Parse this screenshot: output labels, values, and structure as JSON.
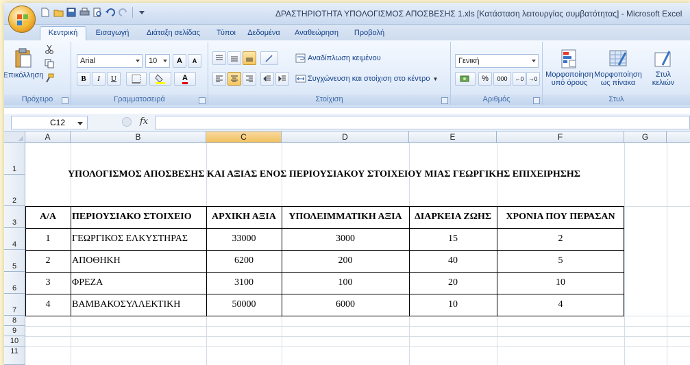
{
  "window": {
    "title": "ΔΡΑΣΤΗΡΙΟΤΗΤΑ ΥΠΟΛΟΓΙΣΜΟΣ ΑΠΟΣΒΕΣΗΣ 1.xls [Κατάσταση λειτουργίας συμβατότητας] - Microsoft Excel"
  },
  "tabs": [
    {
      "label": "Κεντρική",
      "active": true
    },
    {
      "label": "Εισαγωγή"
    },
    {
      "label": "Διάταξη σελίδας"
    },
    {
      "label": "Τύποι"
    },
    {
      "label": "Δεδομένα"
    },
    {
      "label": "Αναθεώρηση"
    },
    {
      "label": "Προβολή"
    }
  ],
  "ribbon": {
    "clipboard": {
      "paste_label": "Επικόλληση",
      "group_label": "Πρόχειρο"
    },
    "font": {
      "font_name": "Arial",
      "font_size": "10",
      "group_label": "Γραμματοσειρά",
      "bold": "B",
      "italic": "I",
      "underline": "U",
      "grow": "A",
      "shrink": "A",
      "color": "A"
    },
    "alignment": {
      "wrap_text": "Αναδίπλωση κειμένου",
      "merge_center": "Συγχώνευση και στοίχιση στο κέντρο",
      "group_label": "Στοίχιση"
    },
    "number": {
      "format": "Γενική",
      "percent": "%",
      "thousands": "000",
      "group_label": "Αριθμός"
    },
    "styles": {
      "conditional": "Μορφοποίηση",
      "conditional_sub": "υπό όρους",
      "table": "Μορφοποίηση",
      "table_sub": "ως πίνακα",
      "cell_styles": "Στυλ",
      "cell_styles_sub": "κελιών",
      "group_label": "Στυλ"
    }
  },
  "formula_bar": {
    "name_box": "C12",
    "fx": "fx",
    "content": ""
  },
  "columns": [
    "A",
    "B",
    "C",
    "D",
    "E",
    "F",
    "G"
  ],
  "selected_column": "C",
  "rows": [
    "1",
    "2",
    "3",
    "4",
    "5",
    "6",
    "7",
    "8",
    "9",
    "10",
    "11"
  ],
  "sheet": {
    "title": "ΥΠΟΛΟΓΙΣΜΟΣ ΑΠΟΣΒΕΣΗΣ ΚΑΙ ΑΞΙΑΣ ΕΝΟΣ ΠΕΡΙΟΥΣΙΑΚΟΥ ΣΤΟΙΧΕΙΟΥ ΜΙΑΣ ΓΕΩΡΓΙΚΗΣ ΕΠΙΧΕΙΡΗΣΗΣ",
    "headers": [
      "Α/Α",
      "ΠΕΡΙΟΥΣΙΑΚΟ ΣΤΟΙΧΕΙΟ",
      "ΑΡΧΙΚΗ ΑΞΙΑ",
      "ΥΠΟΛΕΙΜΜΑΤΙΚΗ ΑΞΙΑ",
      "ΔΙΑΡΚΕΙΑ ΖΩΗΣ",
      "ΧΡΟΝΙΑ ΠΟΥ ΠΕΡΑΣΑΝ"
    ],
    "data": [
      [
        "1",
        "ΓΕΩΡΓΙΚΟΣ ΕΛΚΥΣΤΗΡΑΣ",
        "33000",
        "3000",
        "15",
        "2"
      ],
      [
        "2",
        "ΑΠΟΘΗΚΗ",
        "6200",
        "200",
        "40",
        "5"
      ],
      [
        "3",
        "ΦΡΕΖΑ",
        "3100",
        "100",
        "20",
        "10"
      ],
      [
        "4",
        "ΒΑΜΒΑΚΟΣΥΛΛΕΚΤΙΚΗ",
        "50000",
        "6000",
        "10",
        "4"
      ]
    ]
  }
}
